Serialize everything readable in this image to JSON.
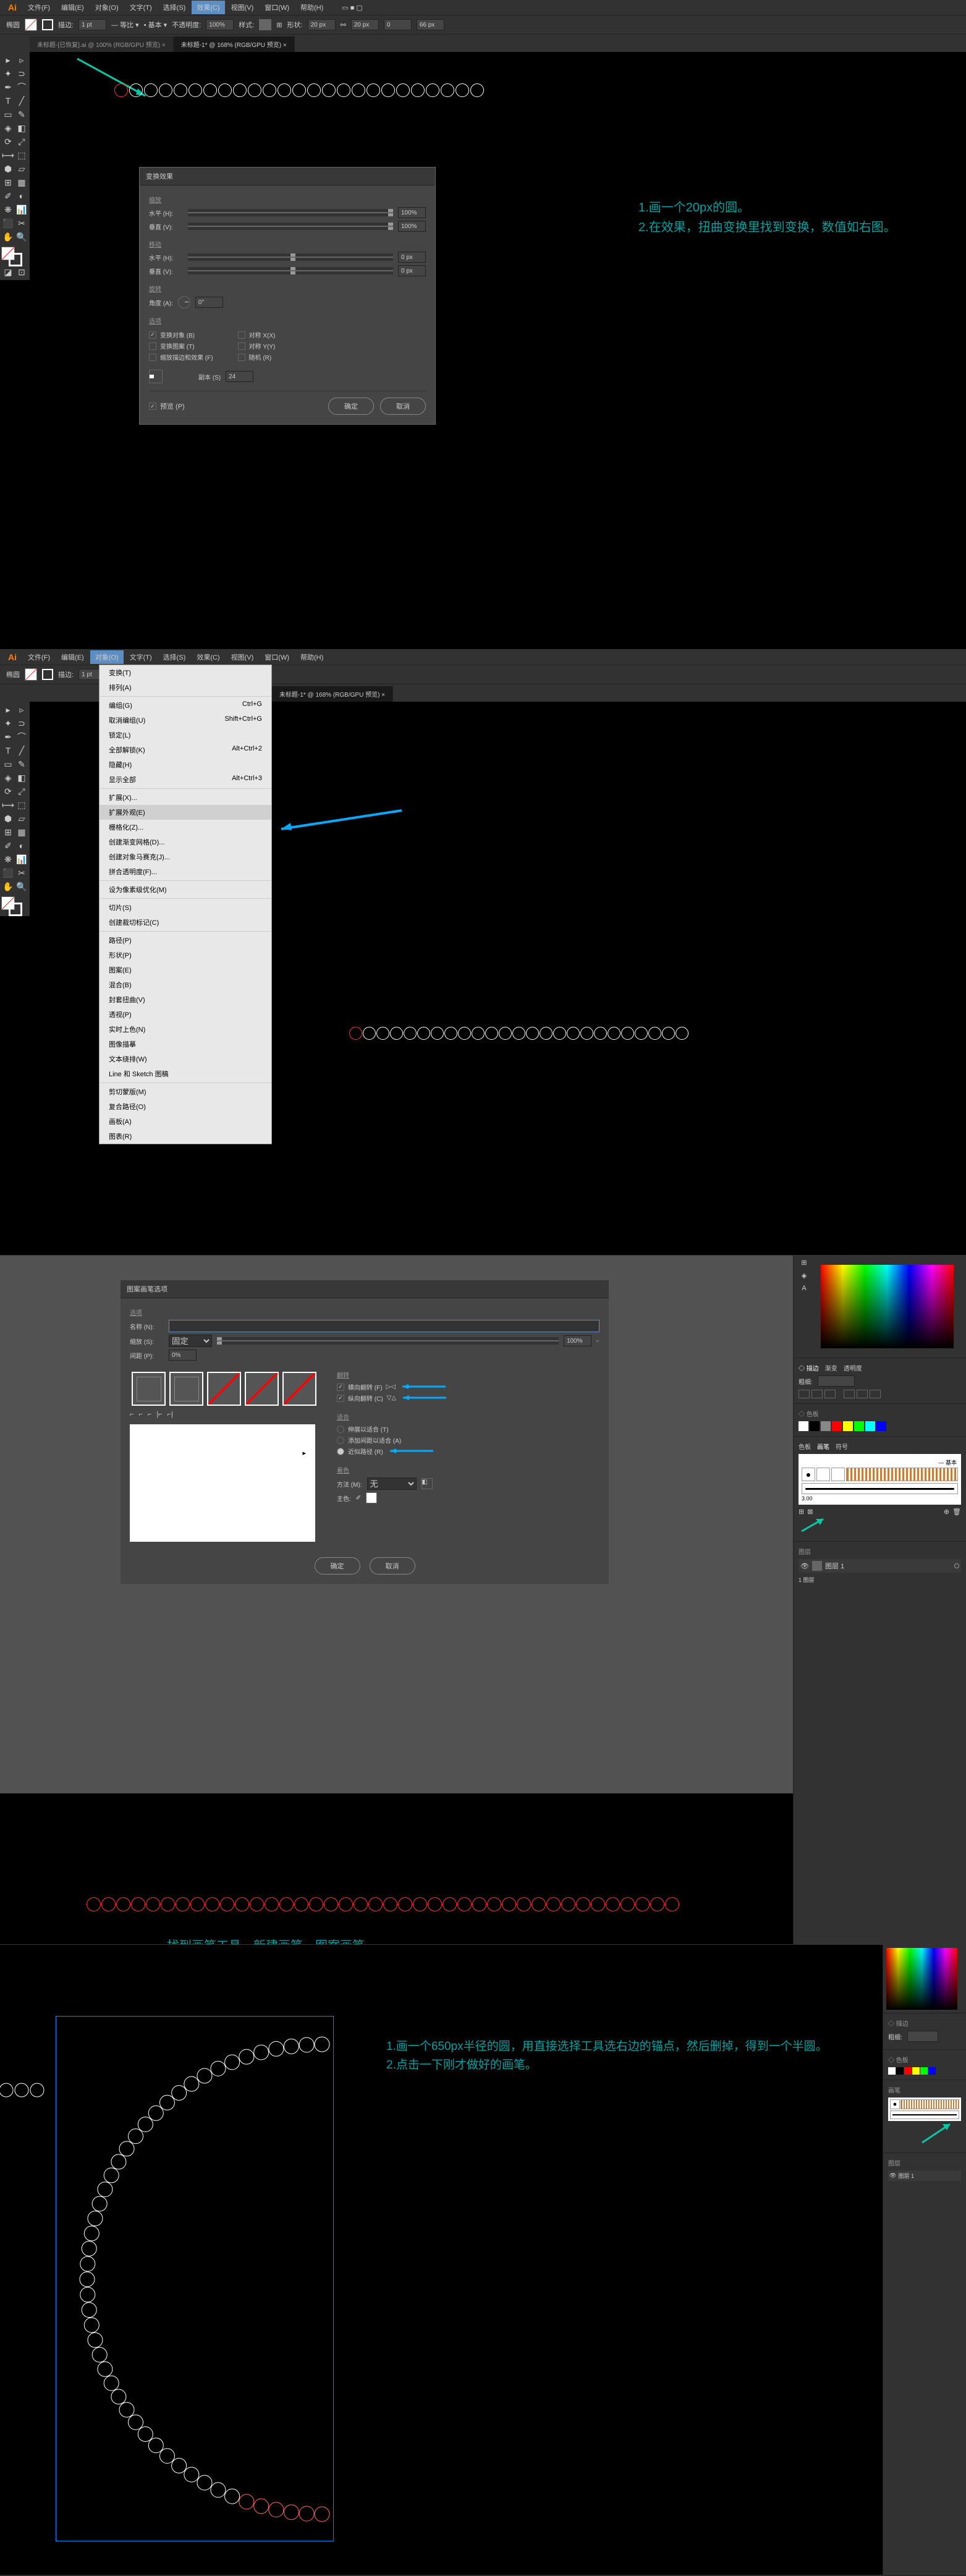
{
  "menubar": {
    "items": [
      "文件(F)",
      "编辑(E)",
      "对象(O)",
      "文字(T)",
      "选择(S)",
      "效果(C)",
      "视图(V)",
      "窗口(W)",
      "帮助(H)"
    ],
    "highlighted": "效果(C)"
  },
  "optionbar": {
    "label1": "椭圆",
    "stroke_label": "描边:",
    "stroke_val": "1 pt",
    "uniform": "等比",
    "basic": "基本",
    "opacity_label": "不透明度:",
    "opacity_val": "100%",
    "style_label": "样式:",
    "shape_label": "形状:",
    "w_val": "20 px",
    "h_val": "20 px",
    "x_val": "0",
    "y_val": "66 px"
  },
  "tabs": {
    "tab1": "未标题-[已恢复].ai @ 100% (RGB/GPU 预览)",
    "tab2": "未标题-1* @ 168% (RGB/GPU 预览)"
  },
  "dialog1": {
    "title": "变换效果",
    "group_scale": "缩放",
    "horiz": "水平 (H):",
    "vert": "垂直 (V):",
    "pct100": "100%",
    "group_move": "移动",
    "move_val": "0 px",
    "group_rotate": "旋转",
    "angle": "角度 (A):",
    "angle_val": "0°",
    "group_options": "选项",
    "transform_obj": "变换对象 (B)",
    "transform_pattern": "变换图案 (T)",
    "scale_stroke": "缩放描边和效果 (F)",
    "reflect_x": "对称 X(X)",
    "reflect_y": "对称 Y(Y)",
    "random": "随机 (R)",
    "copies": "副本 (S)",
    "copies_val": "24",
    "preview": "预览 (P)",
    "ok": "确定",
    "cancel": "取消"
  },
  "instructions1": {
    "line1": "1.画一个20px的圆。",
    "line2": "2.在效果，扭曲变换里找到变换，数值如右图。"
  },
  "section2": {
    "menu_highlight": "对象(O)",
    "dropdown": [
      {
        "label": "变换(T)",
        "key": ""
      },
      {
        "label": "排列(A)",
        "key": ""
      },
      {
        "sep": true
      },
      {
        "label": "编组(G)",
        "key": "Ctrl+G"
      },
      {
        "label": "取消编组(U)",
        "key": "Shift+Ctrl+G"
      },
      {
        "label": "锁定(L)",
        "key": ""
      },
      {
        "label": "全部解锁(K)",
        "key": "Alt+Ctrl+2"
      },
      {
        "label": "隐藏(H)",
        "key": ""
      },
      {
        "label": "显示全部",
        "key": "Alt+Ctrl+3"
      },
      {
        "sep": true
      },
      {
        "label": "扩展(X)...",
        "key": ""
      },
      {
        "label": "扩展外观(E)",
        "key": "",
        "hover": true
      },
      {
        "label": "栅格化(Z)...",
        "key": ""
      },
      {
        "label": "创建渐变网格(D)...",
        "key": ""
      },
      {
        "label": "创建对象马赛克(J)...",
        "key": ""
      },
      {
        "label": "拼合透明度(F)...",
        "key": ""
      },
      {
        "sep": true
      },
      {
        "label": "设为像素级优化(M)",
        "key": ""
      },
      {
        "sep": true
      },
      {
        "label": "切片(S)",
        "key": ""
      },
      {
        "label": "创建裁切标记(C)",
        "key": ""
      },
      {
        "sep": true
      },
      {
        "label": "路径(P)",
        "key": ""
      },
      {
        "label": "形状(P)",
        "key": ""
      },
      {
        "label": "图案(E)",
        "key": ""
      },
      {
        "label": "混合(B)",
        "key": ""
      },
      {
        "label": "封套扭曲(V)",
        "key": ""
      },
      {
        "label": "透视(P)",
        "key": ""
      },
      {
        "label": "实时上色(N)",
        "key": ""
      },
      {
        "label": "图像描摹",
        "key": ""
      },
      {
        "label": "文本绕排(W)",
        "key": ""
      },
      {
        "label": "Line 和 Sketch 图稿",
        "key": ""
      },
      {
        "sep": true
      },
      {
        "label": "剪切蒙版(M)",
        "key": ""
      },
      {
        "label": "复合路径(O)",
        "key": ""
      },
      {
        "label": "画板(A)",
        "key": ""
      },
      {
        "label": "图表(R)",
        "key": ""
      }
    ]
  },
  "dialog3": {
    "title": "图案画笔选项",
    "options": "选项",
    "name_label": "名称 (N):",
    "name_val": "",
    "scale_label": "缩放 (S):",
    "scale_opt": "固定",
    "scale_pct": "100%",
    "spacing_label": "间距 (P):",
    "spacing_val": "0%",
    "flip": "翻转",
    "flip_along": "横向翻转 (F)",
    "flip_across": "纵向翻转 (C)",
    "fit": "适合",
    "stretch": "伸展以适合 (T)",
    "add_space": "添加间距以适合 (A)",
    "approx_path": "近似路径 (R)",
    "colorize": "着色",
    "method": "方法 (M):",
    "method_val": "无",
    "keycolor": "主色:",
    "ok": "确定",
    "cancel": "取消"
  },
  "instruction3": "找到画笔工具，新建画笔，图案画笔",
  "panels": {
    "stroke_title": "描边",
    "gradient": "渐变",
    "transparency": "透明度",
    "weight_label": "粗细:",
    "brushes": "画笔",
    "symbols": "符号",
    "swatches": "色板",
    "basic_brush": "基本",
    "brush_size": "3.00",
    "layers": "图层",
    "layer1": "图层 1",
    "layer_count": "1 图层"
  },
  "instructions4": {
    "line1": "1.画一个650px半径的圆，用直接选择工具选右边的锚点，然后删掉，得到一个半圆。",
    "line2": "2.点击一下刚才做好的画笔。"
  }
}
